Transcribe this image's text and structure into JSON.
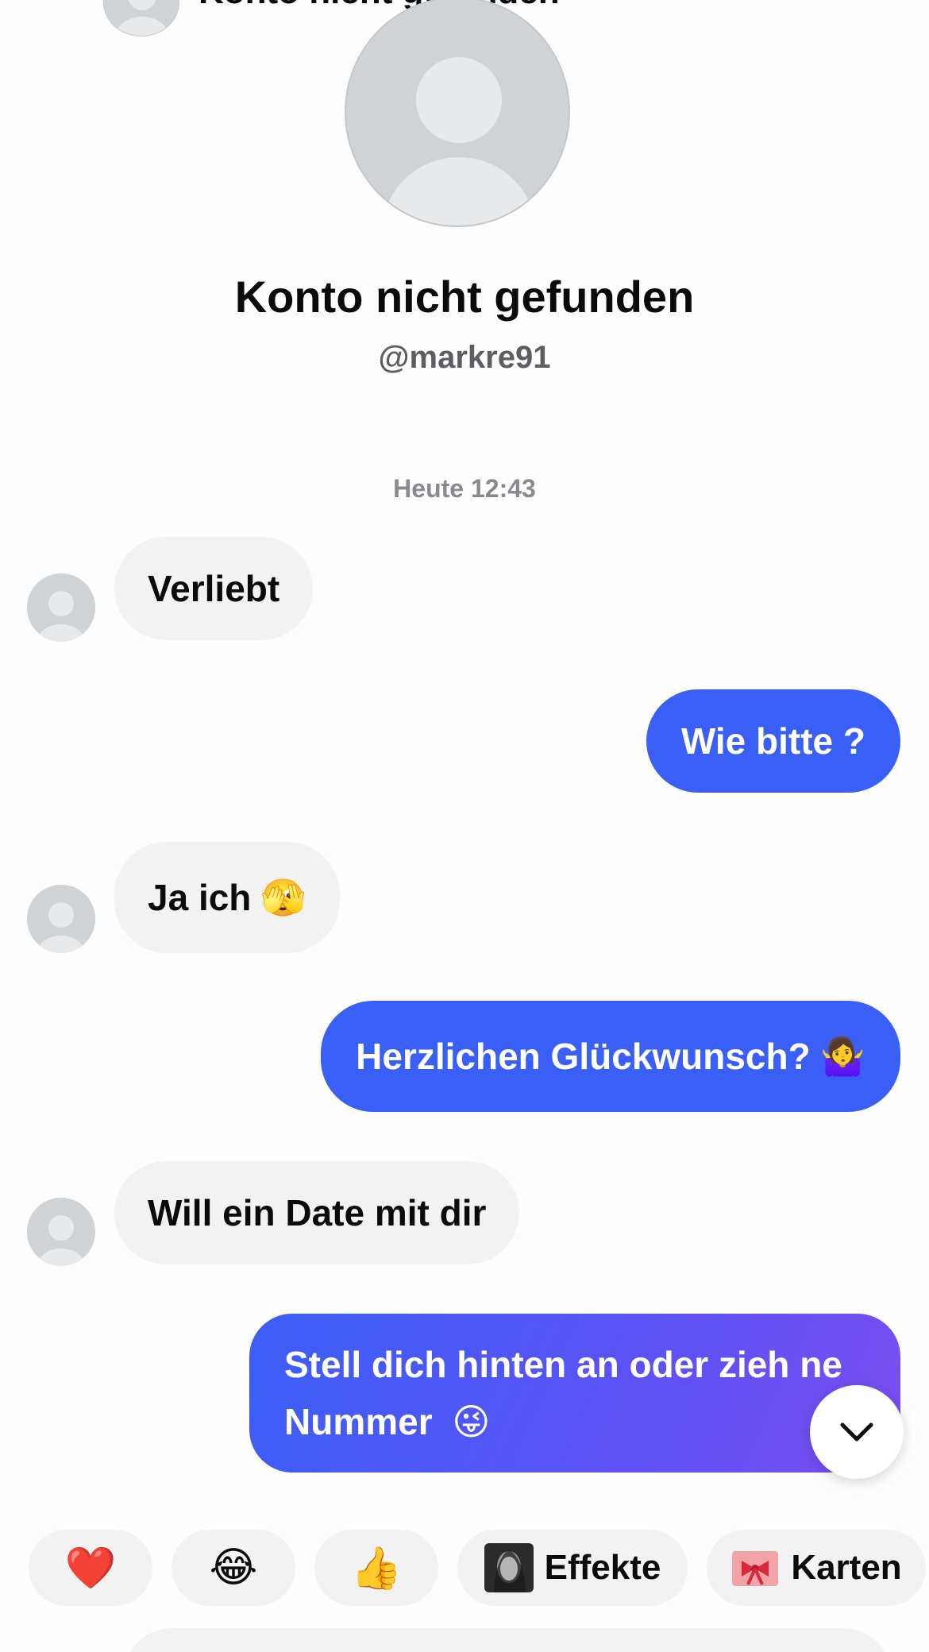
{
  "header": {
    "title": "Konto nicht gefunden",
    "back_icon": "chevron-left-icon",
    "more_icon": "more-horizontal-icon"
  },
  "profile": {
    "name": "Konto nicht gefunden",
    "handle": "@markre91"
  },
  "chat": {
    "timestamp": "Heute 12:43",
    "messages": [
      {
        "direction": "incoming",
        "text": "Verliebt",
        "emoji": ""
      },
      {
        "direction": "outgoing",
        "text": "Wie bitte ?",
        "emoji": ""
      },
      {
        "direction": "incoming",
        "text": "Ja ich",
        "emoji": "🫣"
      },
      {
        "direction": "outgoing",
        "text": "Herzlichen Glückwunsch?",
        "emoji": "🤷‍♀️"
      },
      {
        "direction": "incoming",
        "text": "Will ein Date mit dir",
        "emoji": ""
      },
      {
        "direction": "outgoing",
        "text": "Stell dich hinten an oder zieh ne Nummer",
        "emoji": "😜"
      }
    ]
  },
  "quick_reactions": {
    "heart": "❤️",
    "laugh": "😂",
    "thumbs_up": "👍",
    "effects_label": "Effekte",
    "cards_label": "Karten"
  },
  "colors": {
    "outgoing_bubble": "#3a5ff6",
    "gradient_end": "#7a4ef1",
    "incoming_bubble": "#f2f2f3",
    "background": "#fdfdfe"
  }
}
